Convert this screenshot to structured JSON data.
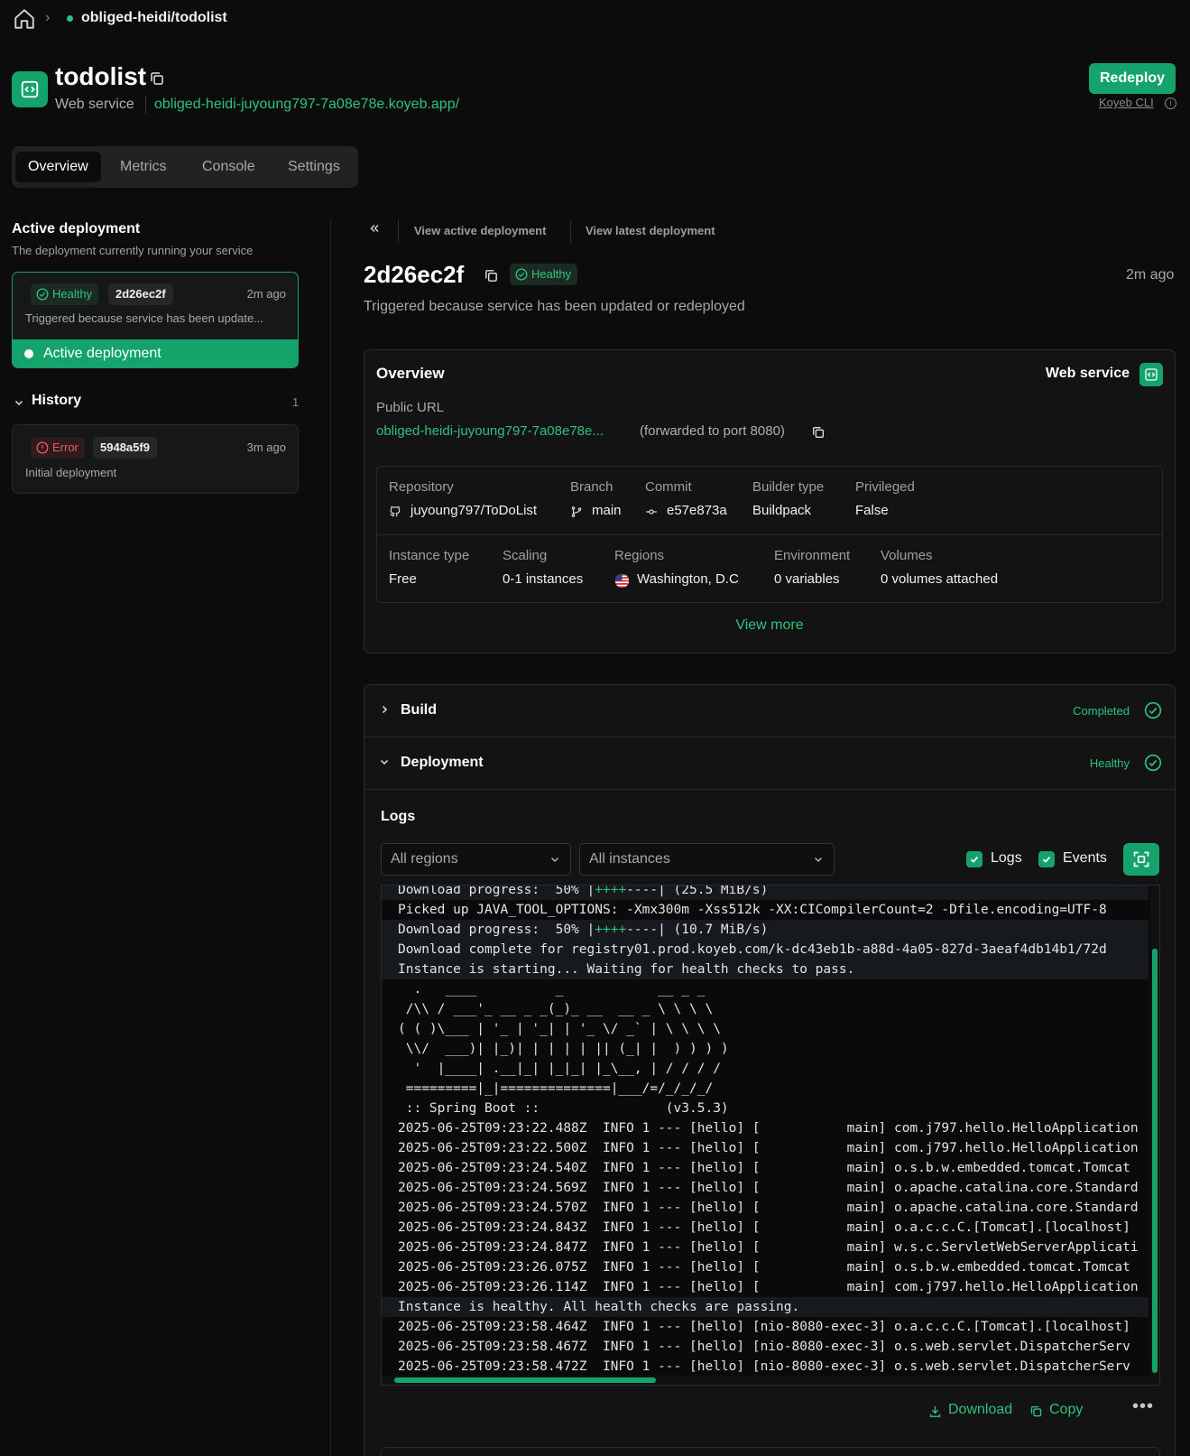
{
  "breadcrumb": {
    "project": "obliged-heidi/todolist"
  },
  "service": {
    "name": "todolist",
    "type": "Web service",
    "url": "obliged-heidi-juyoung797-7a08e78e.koyeb.app/",
    "redeploy_label": "Redeploy",
    "cli_label": "Koyeb CLI"
  },
  "tabs": [
    {
      "label": "Overview",
      "active": true
    },
    {
      "label": "Metrics",
      "active": false
    },
    {
      "label": "Console",
      "active": false
    },
    {
      "label": "Settings",
      "active": false
    }
  ],
  "left": {
    "active_title": "Active deployment",
    "active_sub": "The deployment currently running your service",
    "active_card": {
      "status": "Healthy",
      "hash": "2d26ec2f",
      "ago": "2m ago",
      "text": "Triggered because service has been update...",
      "bar_label": "Active deployment"
    },
    "history_label": "History",
    "history_count": "1",
    "history_items": [
      {
        "status": "Error",
        "hash": "5948a5f9",
        "ago": "3m ago",
        "text": "Initial deployment"
      }
    ]
  },
  "topbar": {
    "view_active": "View active deployment",
    "view_latest": "View latest deployment"
  },
  "deployment": {
    "hash": "2d26ec2f",
    "status": "Healthy",
    "ago": "2m ago",
    "trigger": "Triggered because service has been updated or redeployed"
  },
  "overview": {
    "title": "Overview",
    "service_type": "Web service",
    "public_url_label": "Public URL",
    "public_url": "obliged-heidi-juyoung797-7a08e78e...",
    "forwarded": "(forwarded to port 8080)",
    "row1": {
      "repository_label": "Repository",
      "repository": "juyoung797/ToDoList",
      "branch_label": "Branch",
      "branch": "main",
      "commit_label": "Commit",
      "commit": "e57e873a",
      "builder_label": "Builder type",
      "builder": "Buildpack",
      "privileged_label": "Privileged",
      "privileged": "False"
    },
    "row2": {
      "instance_label": "Instance type",
      "instance": "Free",
      "scaling_label": "Scaling",
      "scaling": "0-1 instances",
      "regions_label": "Regions",
      "region": "Washington, D.C",
      "env_label": "Environment",
      "env": "0 variables",
      "volumes_label": "Volumes",
      "volumes": "0 volumes attached"
    },
    "view_more": "View more"
  },
  "build": {
    "label": "Build",
    "status": "Completed"
  },
  "deploy_section": {
    "label": "Deployment",
    "status": "Healthy"
  },
  "logs": {
    "title": "Logs",
    "region_select": "All regions",
    "instance_select": "All instances",
    "logs_toggle": "Logs",
    "events_toggle": "Events",
    "download_label": "Download",
    "copy_label": "Copy",
    "lines": [
      {
        "text": "Download progress:  50% |++++----| (25.5 MiB/s)",
        "hl": true
      },
      {
        "text": "Picked up JAVA_TOOL_OPTIONS: -Xmx300m -Xss512k -XX:CICompilerCount=2 -Dfile.encoding=UTF-8",
        "hl": false
      },
      {
        "text": "Download progress:  50% |++++----| (10.7 MiB/s)",
        "hl": true
      },
      {
        "text": "Download complete for registry01.prod.koyeb.com/k-dc43eb1b-a88d-4a05-827d-3aeaf4db14b1/72d",
        "hl": true
      },
      {
        "text": "Instance is starting... Waiting for health checks to pass.",
        "hl": true
      },
      {
        "text": "  .   ____          _            __ _ _",
        "hl": false
      },
      {
        "text": " /\\\\ / ___'_ __ _ _(_)_ __  __ _ \\ \\ \\ \\",
        "hl": false
      },
      {
        "text": "( ( )\\___ | '_ | '_| | '_ \\/ _` | \\ \\ \\ \\",
        "hl": false
      },
      {
        "text": " \\\\/  ___)| |_)| | | | | || (_| |  ) ) ) )",
        "hl": false
      },
      {
        "text": "  '  |____| .__|_| |_|_| |_\\__, | / / / /",
        "hl": false
      },
      {
        "text": " =========|_|==============|___/=/_/_/_/",
        "hl": false
      },
      {
        "text": " :: Spring Boot ::                (v3.5.3)",
        "hl": false
      },
      {
        "text": "2025-06-25T09:23:22.488Z  INFO 1 --- [hello] [           main] com.j797.hello.HelloApplication",
        "hl": false
      },
      {
        "text": "2025-06-25T09:23:22.500Z  INFO 1 --- [hello] [           main] com.j797.hello.HelloApplication",
        "hl": false
      },
      {
        "text": "2025-06-25T09:23:24.540Z  INFO 1 --- [hello] [           main] o.s.b.w.embedded.tomcat.Tomcat",
        "hl": false
      },
      {
        "text": "2025-06-25T09:23:24.569Z  INFO 1 --- [hello] [           main] o.apache.catalina.core.Standard",
        "hl": false
      },
      {
        "text": "2025-06-25T09:23:24.570Z  INFO 1 --- [hello] [           main] o.apache.catalina.core.Standard",
        "hl": false
      },
      {
        "text": "2025-06-25T09:23:24.843Z  INFO 1 --- [hello] [           main] o.a.c.c.C.[Tomcat].[localhost]",
        "hl": false
      },
      {
        "text": "2025-06-25T09:23:24.847Z  INFO 1 --- [hello] [           main] w.s.c.ServletWebServerApplicati",
        "hl": false
      },
      {
        "text": "2025-06-25T09:23:26.075Z  INFO 1 --- [hello] [           main] o.s.b.w.embedded.tomcat.Tomcat",
        "hl": false
      },
      {
        "text": "2025-06-25T09:23:26.114Z  INFO 1 --- [hello] [           main] com.j797.hello.HelloApplication",
        "hl": false
      },
      {
        "text": "Instance is healthy. All health checks are passing.",
        "hl": true
      },
      {
        "text": "2025-06-25T09:23:58.464Z  INFO 1 --- [hello] [nio-8080-exec-3] o.a.c.c.C.[Tomcat].[localhost]",
        "hl": false
      },
      {
        "text": "2025-06-25T09:23:58.467Z  INFO 1 --- [hello] [nio-8080-exec-3] o.s.web.servlet.DispatcherServ",
        "hl": false
      },
      {
        "text": "2025-06-25T09:23:58.472Z  INFO 1 --- [hello] [nio-8080-exec-3] o.s.web.servlet.DispatcherServ",
        "hl": false
      }
    ]
  },
  "colors": {
    "accent": "#14a46b",
    "accent_text": "#2ec27e",
    "error": "#ef5a5a",
    "background": "#0c0c0d"
  }
}
